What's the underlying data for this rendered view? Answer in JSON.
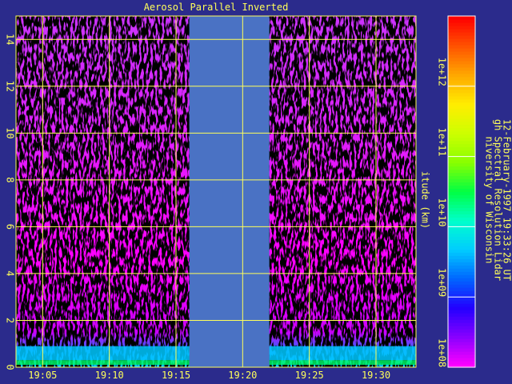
{
  "chart_data": {
    "type": "heatmap",
    "title": "Aerosol Parallel Inverted",
    "ylabel": "itude (km)",
    "xlim": [
      "19:03",
      "19:33"
    ],
    "ylim": [
      0,
      15
    ],
    "x_ticks": [
      "19:05",
      "19:10",
      "19:15",
      "19:20",
      "19:25",
      "19:30"
    ],
    "y_ticks": [
      "0",
      "2",
      "4",
      "6",
      "8",
      "10",
      "12",
      "14"
    ],
    "grid": true,
    "no_data_interval": [
      "19:16",
      "19:22"
    ],
    "colorbar": {
      "scale": "log",
      "range": [
        "1e+08",
        "1e+13"
      ],
      "tick_labels": [
        "1e+08",
        "1e+09",
        "1e+10",
        "1e+11",
        "1e+12"
      ]
    },
    "info_lines": [
      "niversity of Wisconsin",
      "gh Spectral Resolution Lidar",
      "12-February-1997 19:33:26 UT"
    ],
    "colors": {
      "background": "#2b2b8c",
      "no_data": "#4a72c4",
      "grid": "#ffff5a",
      "text": "#ffff5a",
      "low_layer": "#00c8ff",
      "dominant": "#ff00ff"
    }
  }
}
